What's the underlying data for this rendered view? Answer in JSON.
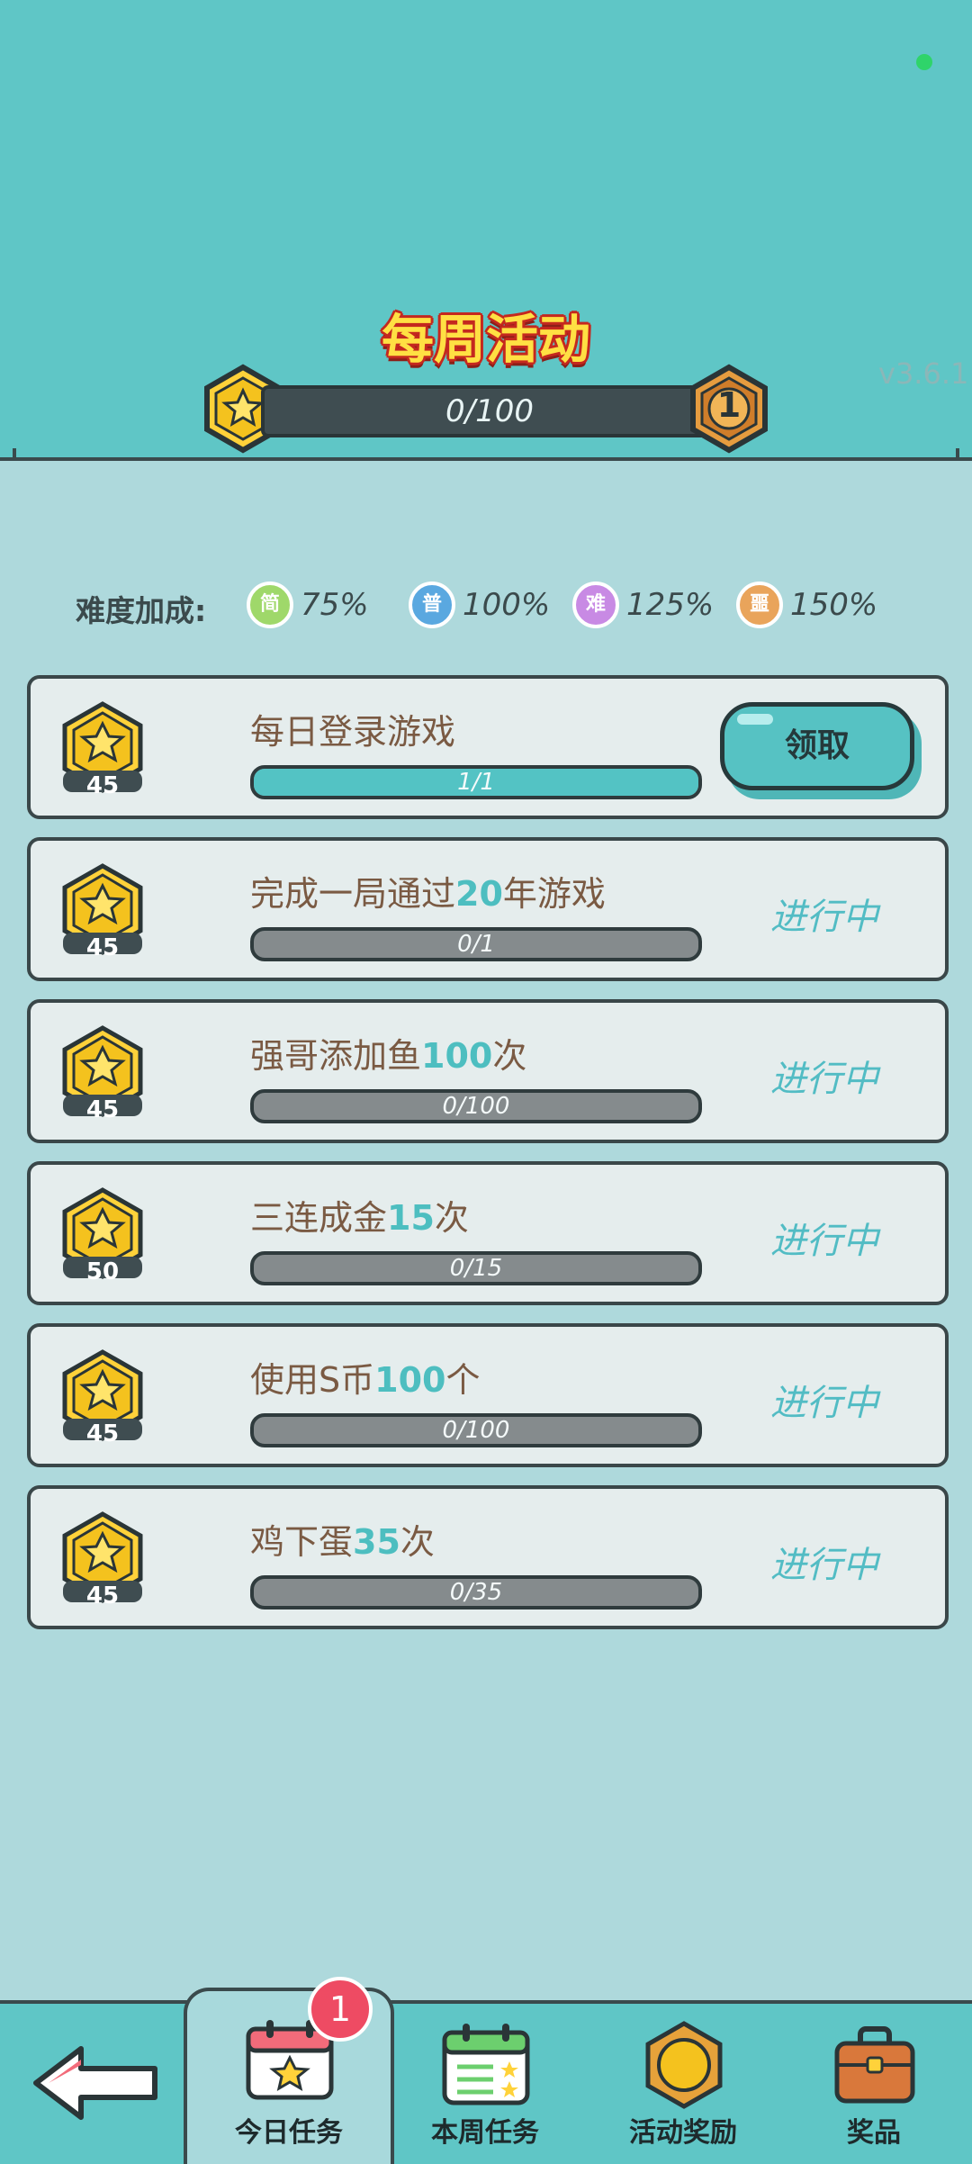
{
  "header": {
    "title": "每周活动",
    "version": "v3.6.1",
    "progress_text": "0/100",
    "progress_fraction": 0,
    "level": "1"
  },
  "bonus": {
    "label": "难度加成:",
    "items": [
      {
        "glyph": "简",
        "value": "75%",
        "color": "#9fd86a"
      },
      {
        "glyph": "普",
        "value": "100%",
        "color": "#5aa8e0"
      },
      {
        "glyph": "难",
        "value": "125%",
        "color": "#c88ae4"
      },
      {
        "glyph": "噩",
        "value": "150%",
        "color": "#e9a45b"
      }
    ]
  },
  "tasks": [
    {
      "reward": "45",
      "name_pre": "每日登录游戏",
      "name_num": "",
      "name_post": "",
      "progress": "1/1",
      "fraction": 1,
      "status": "",
      "action": "领取"
    },
    {
      "reward": "45",
      "name_pre": "完成一局通过",
      "name_num": "20",
      "name_post": "年游戏",
      "progress": "0/1",
      "fraction": 0,
      "status": "进行中",
      "action": ""
    },
    {
      "reward": "45",
      "name_pre": "强哥添加鱼",
      "name_num": "100",
      "name_post": "次",
      "progress": "0/100",
      "fraction": 0,
      "status": "进行中",
      "action": ""
    },
    {
      "reward": "50",
      "name_pre": "三连成金",
      "name_num": "15",
      "name_post": "次",
      "progress": "0/15",
      "fraction": 0,
      "status": "进行中",
      "action": ""
    },
    {
      "reward": "45",
      "name_pre": "使用S币",
      "name_num": "100",
      "name_post": "个",
      "progress": "0/100",
      "fraction": 0,
      "status": "进行中",
      "action": ""
    },
    {
      "reward": "45",
      "name_pre": "鸡下蛋",
      "name_num": "35",
      "name_post": "次",
      "progress": "0/35",
      "fraction": 0,
      "status": "进行中",
      "action": ""
    }
  ],
  "nav": {
    "badge": "1",
    "items": [
      {
        "label": "今日任务",
        "icon": "calendar-star-icon"
      },
      {
        "label": "本周任务",
        "icon": "checklist-calendar-icon"
      },
      {
        "label": "活动奖励",
        "icon": "gold-coin-icon"
      },
      {
        "label": "奖品",
        "icon": "briefcase-icon"
      }
    ],
    "back_icon": "back-arrow-icon"
  },
  "colors": {
    "accent": "#5fc6c6",
    "title": "#ffe043",
    "status": "#52bcc4"
  }
}
